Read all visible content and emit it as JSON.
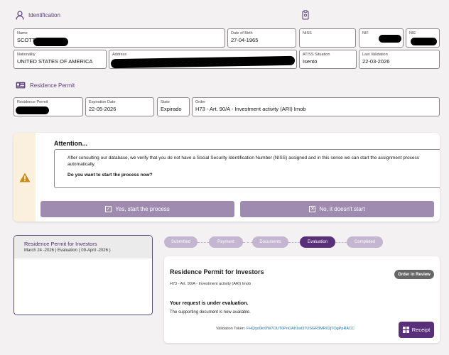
{
  "identification": {
    "title": "Identification",
    "name": {
      "label": "Name",
      "value": "SCOTT"
    },
    "dob": {
      "label": "Date of Birth",
      "value": "27-04-1965"
    },
    "niss": {
      "label": "NISS",
      "value": ""
    },
    "nif": {
      "label": "NIF",
      "value": ""
    },
    "nie": {
      "label": "NIE",
      "value": ""
    },
    "nationality": {
      "label": "Nationality",
      "value": "UNITED STATES OF AMERICA"
    },
    "address": {
      "label": "Address",
      "value": ""
    },
    "situation": {
      "label": "AT/SS Situation",
      "value": "Isento"
    },
    "last_validation": {
      "label": "Last Validation",
      "value": "22-03-2026"
    }
  },
  "residence": {
    "title": "Residence Permit",
    "permit": {
      "label": "Residence Permit",
      "value": ""
    },
    "expiration": {
      "label": "Expiration Date",
      "value": "22-05-2026"
    },
    "state": {
      "label": "State",
      "value": "Expirado"
    },
    "order": {
      "label": "Order",
      "value": "H73 - Art. 90/A - Investment activity (ARI) Imob"
    }
  },
  "alert": {
    "title": "Attention...",
    "message": "After consulting our database, we verify that you do not have a Social Security Identification Number (NISS) assigned and in this sense we can start the assignment process automatically.",
    "question": "Do you want to start the process now?",
    "yes_label": "Yes, start the process",
    "no_label": "No, it doesn't start",
    "warning_color": "#c98a1a"
  },
  "process_card": {
    "title": "Residence Permit for Investors",
    "subtitle": "March 24 -2026 | Evaluation ( 09-April -2026 )"
  },
  "steps": [
    "Submitted",
    "Payment",
    "Documents",
    "Evaluation",
    "Completed"
  ],
  "active_step": "Evaluation",
  "detail": {
    "title": "Residence Permit for Investors",
    "subtitle": "H73 - Art. 90/A - Investment activity (ARI) Imob",
    "status_badge": "Order in Review",
    "status_heading": "Your request is under evaluation.",
    "status_text": "The supporting document is now available.",
    "token_label": "Validation Token:",
    "token_value": "FHQqo0krDW7OUT0PnOAh1wl37USGR3MR02jTOgPpRACC",
    "receipt_label": "Receipt"
  },
  "colors": {
    "accent": "#5a2f7a",
    "button": "#9f8ab0",
    "step_inactive": "#c4b6d0"
  }
}
